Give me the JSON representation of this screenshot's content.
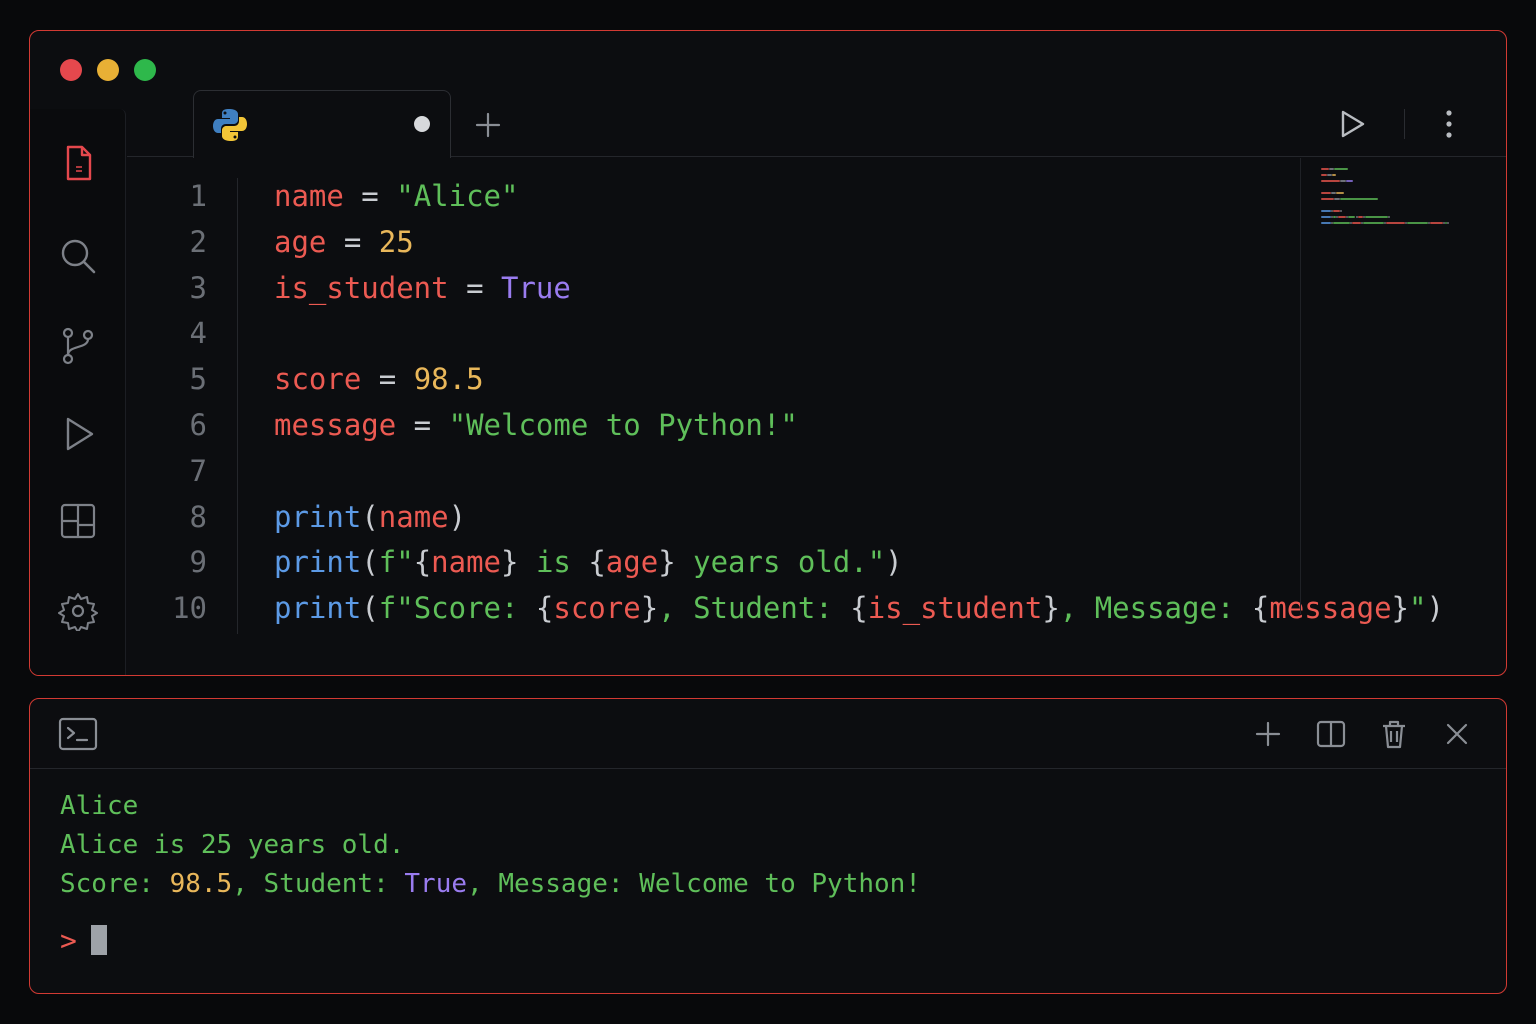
{
  "window": {
    "traffic_lights": [
      "close",
      "minimize",
      "maximize"
    ],
    "colors": {
      "border": "#d23a33",
      "close": "#e5484d",
      "minimize": "#e8b035",
      "maximize": "#2eb84b"
    }
  },
  "activity_bar": {
    "items": [
      {
        "icon": "file-icon",
        "active": true
      },
      {
        "icon": "search-icon"
      },
      {
        "icon": "source-control-icon"
      },
      {
        "icon": "run-icon"
      },
      {
        "icon": "extensions-icon"
      },
      {
        "icon": "gear-icon"
      }
    ]
  },
  "tab": {
    "label": "",
    "icon": "python-icon",
    "modified": true
  },
  "toolbar": {
    "run_icon": "play-icon",
    "more_icon": "more-vertical-icon",
    "new_tab_icon": "plus-icon"
  },
  "editor": {
    "line_numbers": [
      "1",
      "2",
      "3",
      "4",
      "5",
      "6",
      "7",
      "8",
      "9",
      "10"
    ],
    "lines": [
      [
        [
          "v",
          "name"
        ],
        [
          "o",
          " = "
        ],
        [
          "s",
          "\"Alice\""
        ]
      ],
      [
        [
          "v",
          "age"
        ],
        [
          "o",
          " = "
        ],
        [
          "n",
          "25"
        ]
      ],
      [
        [
          "v",
          "is_student"
        ],
        [
          "o",
          " = "
        ],
        [
          "b",
          "True"
        ]
      ],
      [],
      [
        [
          "v",
          "score"
        ],
        [
          "o",
          " = "
        ],
        [
          "n",
          "98.5"
        ]
      ],
      [
        [
          "v",
          "message"
        ],
        [
          "o",
          " = "
        ],
        [
          "s",
          "\"Welcome to Python!\""
        ]
      ],
      [],
      [
        [
          "f",
          "print"
        ],
        [
          "p",
          "("
        ],
        [
          "v",
          "name"
        ],
        [
          "p",
          ")"
        ]
      ],
      [
        [
          "f",
          "print"
        ],
        [
          "p",
          "("
        ],
        [
          "s",
          "f\""
        ],
        [
          "p",
          "{"
        ],
        [
          "v",
          "name"
        ],
        [
          "p",
          "}"
        ],
        [
          "s",
          " is "
        ],
        [
          "p",
          "{"
        ],
        [
          "v",
          "age"
        ],
        [
          "p",
          "}"
        ],
        [
          "s",
          " years old.\""
        ],
        [
          "p",
          ")"
        ]
      ],
      [
        [
          "f",
          "print"
        ],
        [
          "p",
          "("
        ],
        [
          "s",
          "f\"Score: "
        ],
        [
          "p",
          "{"
        ],
        [
          "v",
          "score"
        ],
        [
          "p",
          "}"
        ],
        [
          "s",
          ", Student: "
        ],
        [
          "p",
          "{"
        ],
        [
          "v",
          "is_student"
        ],
        [
          "p",
          "}"
        ],
        [
          "s",
          ", Message: "
        ],
        [
          "p",
          "{"
        ],
        [
          "v",
          "message"
        ],
        [
          "p",
          "}"
        ],
        [
          "s",
          "\""
        ],
        [
          "p",
          ")"
        ]
      ]
    ]
  },
  "terminal": {
    "header_icon": "terminal-icon",
    "actions": [
      "plus-icon",
      "split-icon",
      "trash-icon",
      "close-icon"
    ],
    "output": [
      [
        [
          "s",
          "Alice"
        ]
      ],
      [
        [
          "s",
          "Alice is 25 years old."
        ]
      ],
      [
        [
          "s",
          "Score: "
        ],
        [
          "n",
          "98.5"
        ],
        [
          "s",
          ", Student: "
        ],
        [
          "b",
          "True"
        ],
        [
          "s",
          ", Message: Welcome to Python!"
        ]
      ]
    ],
    "prompt": ">"
  }
}
